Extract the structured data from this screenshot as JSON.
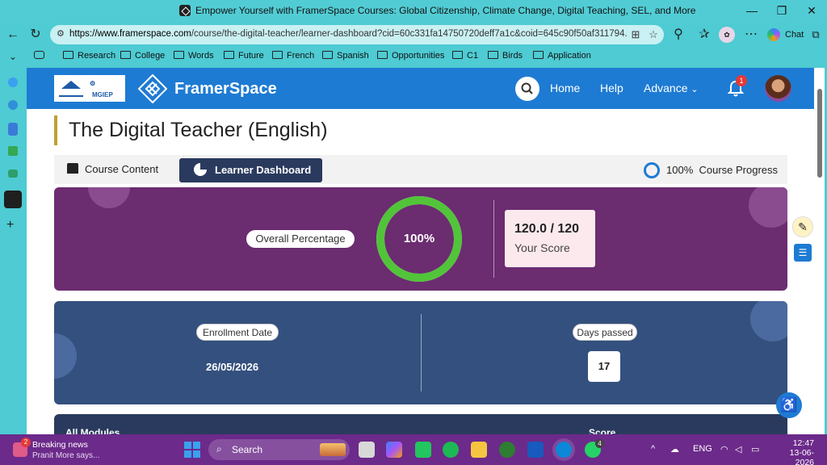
{
  "window": {
    "title": "Empower Yourself with FramerSpace Courses: Global Citizenship, Climate Change, Digital Teaching, SEL, and More"
  },
  "browser": {
    "url_host": "https://www.framerspace.com",
    "url_path": "/course/the-digital-teacher/learner-dashboard?cid=60c331fa14750720deff7a1c&coid=645c90f50af311794...",
    "chat_label": "Chat",
    "bookmarks": [
      "Research",
      "College",
      "Words",
      "Future",
      "French",
      "Spanish",
      "Opportunities",
      "C1",
      "Birds",
      "Application"
    ]
  },
  "site": {
    "logo_badge_line1": "MGIEP",
    "brand_name": "FramerSpace",
    "nav": {
      "home": "Home",
      "help": "Help",
      "advance": "Advance",
      "notification_count": "1"
    }
  },
  "course": {
    "title": "The Digital Teacher (English)",
    "tabs": {
      "content": "Course Content",
      "learner": "Learner Dashboard"
    },
    "progress_percent": "100%",
    "progress_label": "Course Progress"
  },
  "overall": {
    "label": "Overall Percentage",
    "percent_value": 100,
    "percent_text": "100%",
    "score_value": "120.0 / 120",
    "score_label": "Your Score"
  },
  "enrollment": {
    "label": "Enrollment Date",
    "date": "26/05/2026",
    "days_label": "Days passed",
    "days_value": "17"
  },
  "modules": {
    "col1": "All Modules",
    "col2": "Score"
  },
  "taskbar": {
    "news_title": "Breaking news",
    "news_sub": "Pranit More says...",
    "news_badge": "2",
    "search_label": "Search",
    "whatsapp_badge": "4",
    "language": "ENG",
    "time": "12:47",
    "date": "13-06-2026"
  },
  "colors": {
    "nav_blue": "#1e7bd3",
    "purple_card": "#6b2c70",
    "blue_card": "#34507e",
    "donut_green": "#52c43a",
    "taskbar": "#6c2a8a"
  }
}
